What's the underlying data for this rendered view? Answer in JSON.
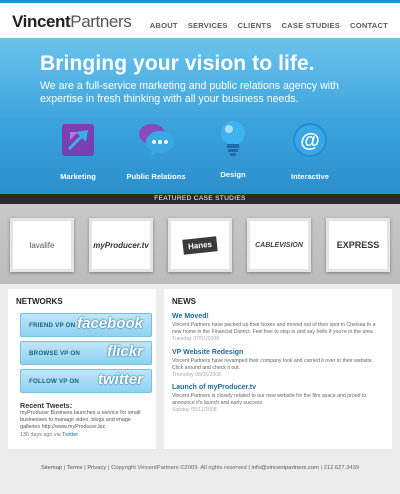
{
  "header": {
    "logo_first": "Vincent",
    "logo_second": "Partners",
    "nav": [
      "ABOUT",
      "SERVICES",
      "CLIENTS",
      "CASE STUDIES",
      "CONTACT"
    ]
  },
  "hero": {
    "title": "Bringing your vision to life.",
    "subtitle": "We are a full-service marketing and public relations agency with expertise in fresh thinking with all your business needs."
  },
  "services": [
    {
      "label": "Marketing",
      "icon": "arrows-icon"
    },
    {
      "label": "Public Relations",
      "icon": "speech-bubbles-icon"
    },
    {
      "label": "Design",
      "icon": "lightbulb-icon"
    },
    {
      "label": "Interactive",
      "icon": "at-sign-icon"
    }
  ],
  "featured": {
    "label": "FEATURED CASE STUDIES",
    "cases": [
      "lavalife",
      "myProducer.tv",
      "Hanes",
      "CABLEVISION",
      "EXPRESS"
    ]
  },
  "networks": {
    "title": "NETWORKS",
    "buttons": [
      {
        "small": "FRIEND VP ON",
        "big": "facebook"
      },
      {
        "small": "BROWSE VP ON",
        "big": "flickr"
      },
      {
        "small": "FOLLOW VP ON",
        "big": "twitter"
      }
    ],
    "tweets_title": "Recent Tweets:",
    "tweet_text": "myProducer Business launches a service for small businesses to manage video, blogs and image galleries http://www.myProducer.biz",
    "tweet_time": "136 days ago via ",
    "tweet_via": "Twitter"
  },
  "news": {
    "title": "NEWS",
    "items": [
      {
        "title": "We Moved!",
        "body": "Vincent Partners have packed up their boxes and moved out of their spot in Chelsea to a new home in the Financial District. Feel free to stop in and say hello if you're in the area.",
        "date": "Tuesday 07/01/2008"
      },
      {
        "title": "VP Website Redesign",
        "body": "Vincent Partners have revamped their company look and carried it over to their website. Click around and check it out.",
        "date": "Thursday 06/05/2008"
      },
      {
        "title": "Launch of myProducer.tv",
        "body": "Vincent Partners is closely related to our new website for the film space and proud to announce it's launch and early success.",
        "date": "Sunday 05/11/2008"
      }
    ]
  },
  "footer": {
    "sitemap": "Sitemap",
    "terms": "Terms",
    "privacy": "Privacy",
    "copyright": "Copyright VincentPartners ©2009. All rights reserved",
    "email": "info@vincentpartners.com",
    "phone": "212.627.3439"
  }
}
